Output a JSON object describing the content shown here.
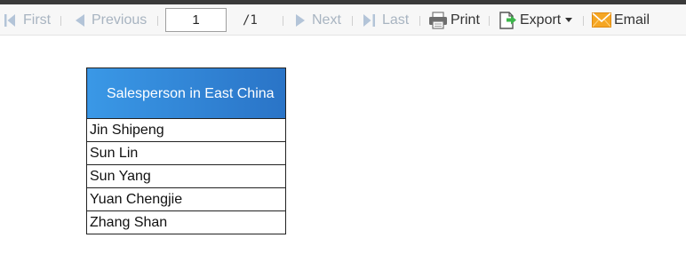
{
  "toolbar": {
    "first_label": "First",
    "previous_label": "Previous",
    "current_page": "1",
    "total_pages": "/1",
    "next_label": "Next",
    "last_label": "Last",
    "print_label": "Print",
    "export_label": "Export",
    "email_label": "Email",
    "colors": {
      "disabled_text": "#a8b4c1",
      "disabled_icon": "#b3c4d8",
      "enabled_text": "#333333",
      "export_icon_green": "#3cb54a",
      "email_icon_orange": "#f5a623"
    },
    "icons": {
      "first": "first-page-icon",
      "previous": "previous-page-icon",
      "next": "next-page-icon",
      "last": "last-page-icon",
      "print": "printer-icon",
      "export": "export-icon",
      "export_dropdown": "caret-down-icon",
      "email": "envelope-icon"
    }
  },
  "report": {
    "header": "Salesperson in East China",
    "header_gradient": [
      "#3a98e6",
      "#2a74c7"
    ],
    "rows": [
      "Jin Shipeng",
      "Sun Lin",
      "Sun Yang",
      "Yuan Chengjie",
      "Zhang Shan"
    ]
  }
}
